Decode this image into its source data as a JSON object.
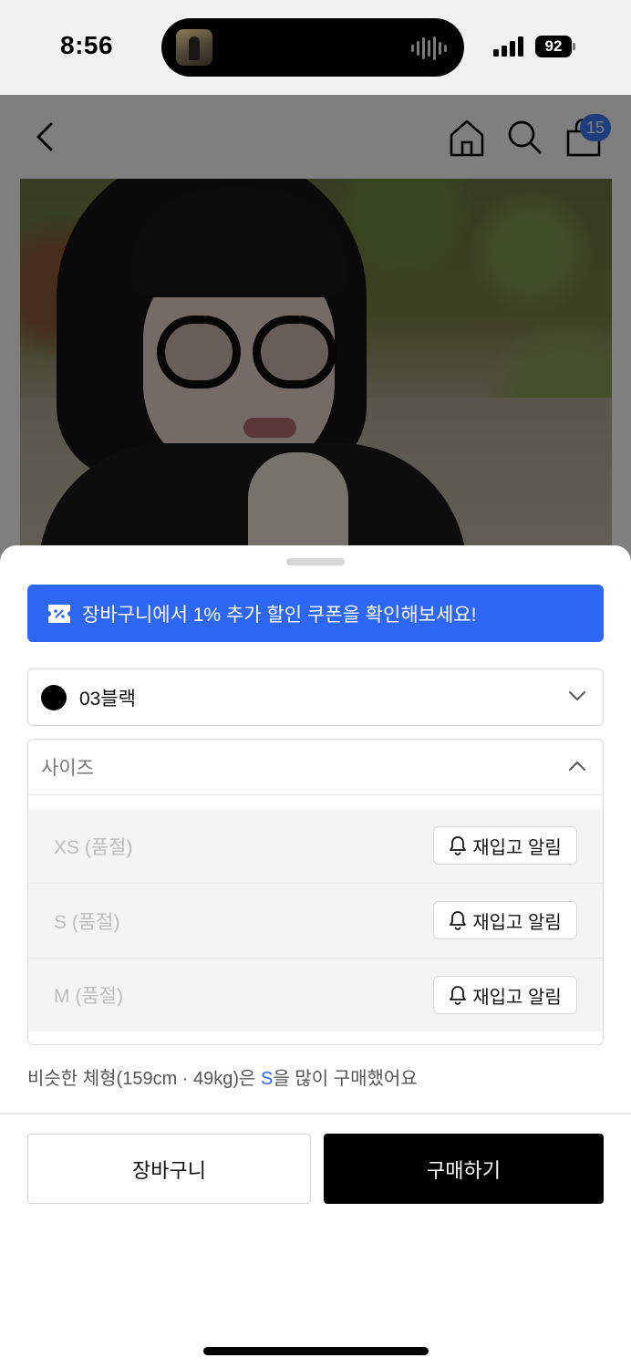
{
  "status_bar": {
    "time": "8:56",
    "battery": "92"
  },
  "header": {
    "cart_count": "15"
  },
  "icons": {
    "back": "chevron-left-icon",
    "home": "home-icon",
    "search": "search-icon",
    "cart": "shopping-bag-icon",
    "coupon": "coupon-icon",
    "bell": "bell-icon"
  },
  "sheet": {
    "coupon_banner": "장바구니에서 1% 추가 할인 쿠폰을 확인해보세요!",
    "color_option": {
      "selected_label": "03블랙",
      "swatch_color": "#000000"
    },
    "size_option": {
      "placeholder": "사이즈",
      "sizes": [
        {
          "label": "XS (품절)",
          "restock_label": "재입고 알림"
        },
        {
          "label": "S (품절)",
          "restock_label": "재입고 알림"
        },
        {
          "label": "M (품절)",
          "restock_label": "재입고 알림"
        }
      ]
    },
    "recommendation": {
      "prefix": "비슷한 체형(159cm · 49kg)은 ",
      "size": "S",
      "suffix": "을 많이 구매했어요"
    },
    "buttons": {
      "cart": "장바구니",
      "buy": "구매하기"
    }
  },
  "colors": {
    "accent": "#2E66F6",
    "badge": "#3B7CF7",
    "buy_button": "#000000"
  }
}
